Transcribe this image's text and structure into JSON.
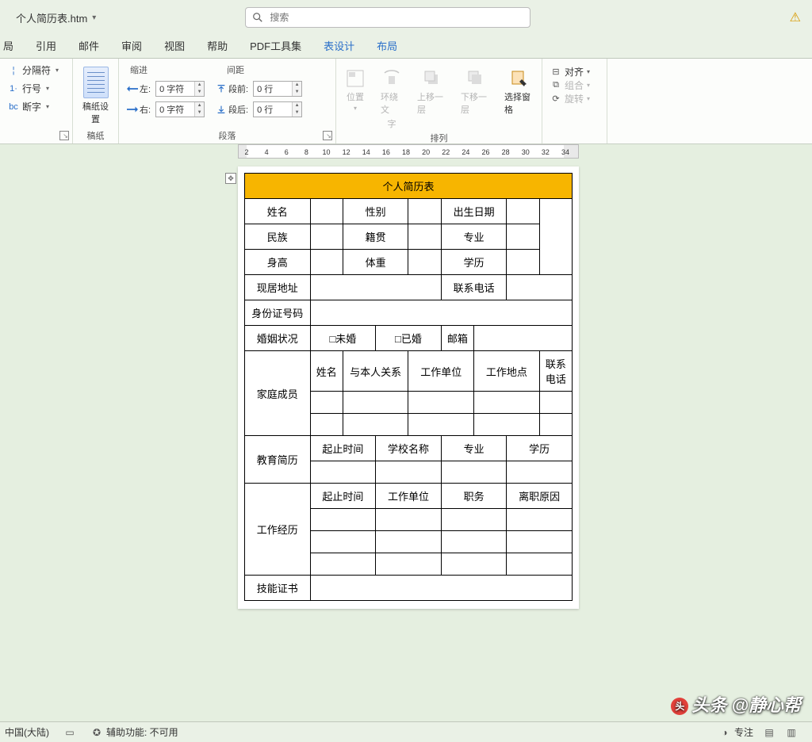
{
  "titlebar": {
    "doc_name": "个人简历表.htm",
    "search_placeholder": "搜索"
  },
  "tabs": [
    "局",
    "引用",
    "邮件",
    "审阅",
    "视图",
    "帮助",
    "PDF工具集",
    "表设计",
    "布局"
  ],
  "active_tabs": [
    "表设计",
    "布局"
  ],
  "ribbon": {
    "groupA": {
      "breaks": "分隔符",
      "linenum": "行号",
      "hyphen": "断字"
    },
    "groupB": {
      "label": "稿纸",
      "name": "稿纸设置"
    },
    "groupC": {
      "indent_hdr": "缩进",
      "spacing_hdr": "间距",
      "group_label": "段落",
      "left": "左:",
      "right": "右:",
      "before": "段前:",
      "after": "段后:",
      "left_val": "0 字符",
      "right_val": "0 字符",
      "before_val": "0 行",
      "after_val": "0 行"
    },
    "groupD": {
      "group_label": "排列",
      "pos": "位置",
      "wrap1": "环绕文",
      "wrap2": "字",
      "up": "上移一层",
      "down": "下移一层",
      "pane": "选择窗格"
    },
    "groupE": {
      "align": "对齐",
      "group": "组合",
      "rotate": "旋转"
    }
  },
  "ruler_numbers": [
    2,
    4,
    6,
    8,
    10,
    12,
    14,
    16,
    18,
    20,
    22,
    24,
    26,
    28,
    30,
    32,
    34
  ],
  "doc": {
    "title": "个人简历表",
    "r1": {
      "name": "姓名",
      "gender": "性别",
      "dob": "出生日期"
    },
    "r2": {
      "nation": "民族",
      "native": "籍贯",
      "major": "专业"
    },
    "r3": {
      "height": "身高",
      "weight": "体重",
      "edu": "学历"
    },
    "r4": {
      "addr": "现居地址",
      "tel": "联系电话"
    },
    "r5": {
      "id": "身份证号码"
    },
    "r6": {
      "marital": "婚姻状况",
      "unmarried": "□未婚",
      "married": "□已婚",
      "email": "邮箱"
    },
    "family": {
      "label": "家庭成员",
      "cols": [
        "姓名",
        "与本人关系",
        "工作单位",
        "工作地点",
        "联系电话"
      ]
    },
    "edu_hist": {
      "label": "教育简历",
      "cols": [
        "起止时间",
        "学校名称",
        "专业",
        "学历"
      ]
    },
    "work_hist": {
      "label": "工作经历",
      "cols": [
        "起止时间",
        "工作单位",
        "职务",
        "离职原因"
      ]
    },
    "skills": "技能证书"
  },
  "status": {
    "locale": "中国(大陆)",
    "a11y": "辅助功能: 不可用",
    "focus": "专注"
  },
  "watermark": {
    "prefix": "头条",
    "author": "@静心帮"
  }
}
